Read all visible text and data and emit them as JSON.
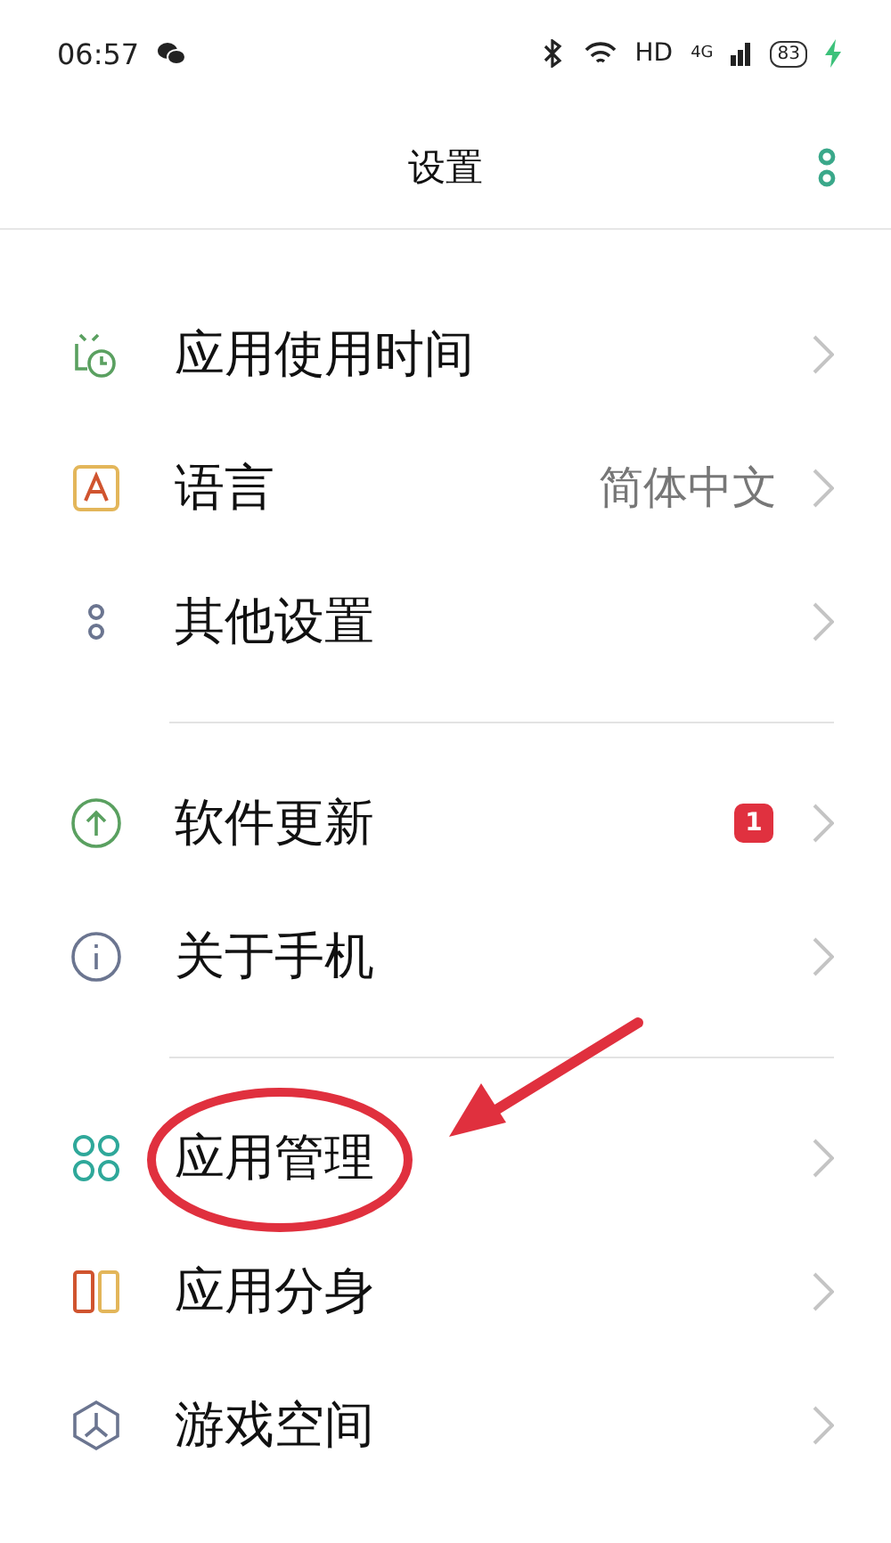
{
  "status_bar": {
    "time": "06:57",
    "network_label": "HD",
    "signal_label": "4G",
    "battery": "83",
    "charging": true
  },
  "header": {
    "title": "设置"
  },
  "groups": [
    {
      "items": [
        {
          "label": "应用使用时间"
        },
        {
          "label": "语言",
          "value": "简体中文"
        },
        {
          "label": "其他设置"
        }
      ]
    },
    {
      "items": [
        {
          "label": "软件更新",
          "badge": "1"
        },
        {
          "label": "关于手机"
        }
      ]
    },
    {
      "items": [
        {
          "label": "应用管理"
        },
        {
          "label": "应用分身"
        },
        {
          "label": "游戏空间"
        }
      ]
    }
  ],
  "annotation": {
    "kind": "circle_and_arrow"
  }
}
